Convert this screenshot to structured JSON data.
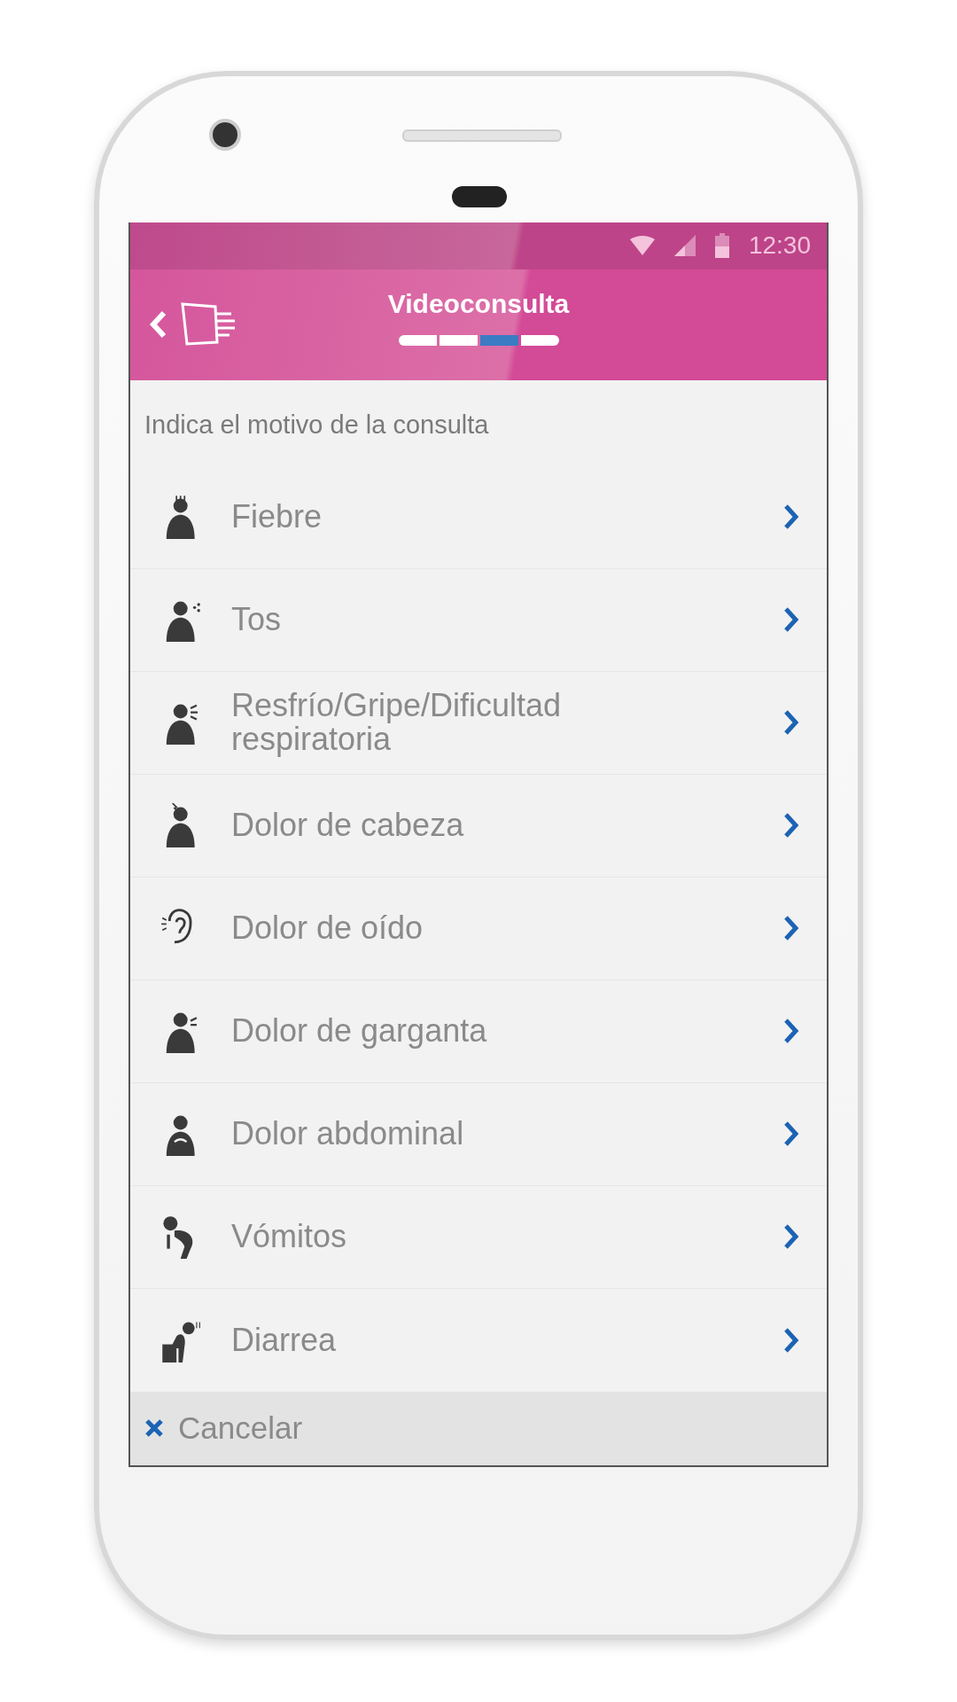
{
  "status_bar": {
    "time": "12:30"
  },
  "header": {
    "title": "Videoconsulta",
    "steps": [
      {
        "selected": false
      },
      {
        "selected": false
      },
      {
        "selected": true
      },
      {
        "selected": false
      }
    ]
  },
  "prompt": "Indica el motivo de la consulta",
  "reasons": [
    {
      "label": "Fiebre"
    },
    {
      "label": "Tos"
    },
    {
      "label": "Resfrío/Gripe/Dificultad respiratoria"
    },
    {
      "label": "Dolor de cabeza"
    },
    {
      "label": "Dolor de oído"
    },
    {
      "label": "Dolor de garganta"
    },
    {
      "label": "Dolor abdominal"
    },
    {
      "label": "Vómitos"
    },
    {
      "label": "Diarrea"
    }
  ],
  "cancel": {
    "label": "Cancelar"
  }
}
